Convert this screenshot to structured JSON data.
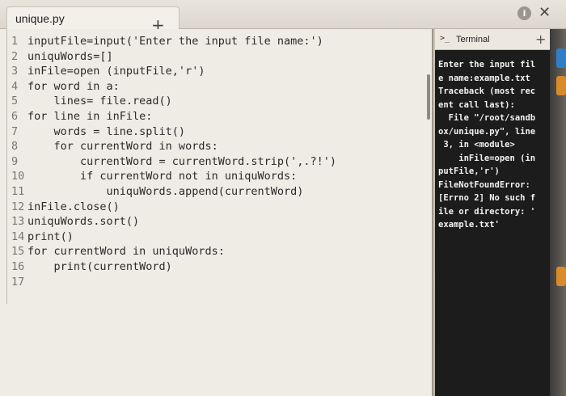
{
  "editor_tab": {
    "filename": "unique.py",
    "new_tab_label": "+"
  },
  "window_controls": {
    "info_icon": "i",
    "close_icon": "✕"
  },
  "code_lines": [
    {
      "n": "1",
      "text": "inputFile=input('Enter the input file name:')"
    },
    {
      "n": "2",
      "text": "uniquWords=[]"
    },
    {
      "n": "3",
      "text": "inFile=open (inputFile,'r')"
    },
    {
      "n": "4",
      "text": "for word in a:"
    },
    {
      "n": "5",
      "text": "    lines= file.read()"
    },
    {
      "n": "6",
      "text": "for line in inFile:"
    },
    {
      "n": "7",
      "text": "    words = line.split()"
    },
    {
      "n": "8",
      "text": "    for currentWord in words:"
    },
    {
      "n": "9",
      "text": "        currentWord = currentWord.strip(',.?!')"
    },
    {
      "n": "10",
      "text": "        if currentWord not in uniquWords:"
    },
    {
      "n": "11",
      "text": "            uniquWords.append(currentWord)"
    },
    {
      "n": "12",
      "text": "inFile.close()"
    },
    {
      "n": "13",
      "text": "uniquWords.sort()"
    },
    {
      "n": "14",
      "text": "print()"
    },
    {
      "n": "15",
      "text": "for currentWord in uniquWords:"
    },
    {
      "n": "16",
      "text": "    print(currentWord)"
    },
    {
      "n": "17",
      "text": ""
    }
  ],
  "terminal": {
    "prompt_icon": ">_",
    "title": "Terminal",
    "add_label": "+",
    "output": "Enter the input fil\ne name:example.txt\nTraceback (most rec\nent call last):\n  File \"/root/sandb\nox/unique.py\", line\n 3, in <module>\n    inFile=open (in\nputFile,'r')\nFileNotFoundError:\n[Errno 2] No such f\nile or directory: '\nexample.txt'"
  },
  "colors": {
    "editor_bg": "#efece5",
    "terminal_bg": "#1c1c1c",
    "keyword": "#2e4fa0",
    "chip_blue": "#2f7fc8",
    "chip_orange": "#d98a2b"
  }
}
